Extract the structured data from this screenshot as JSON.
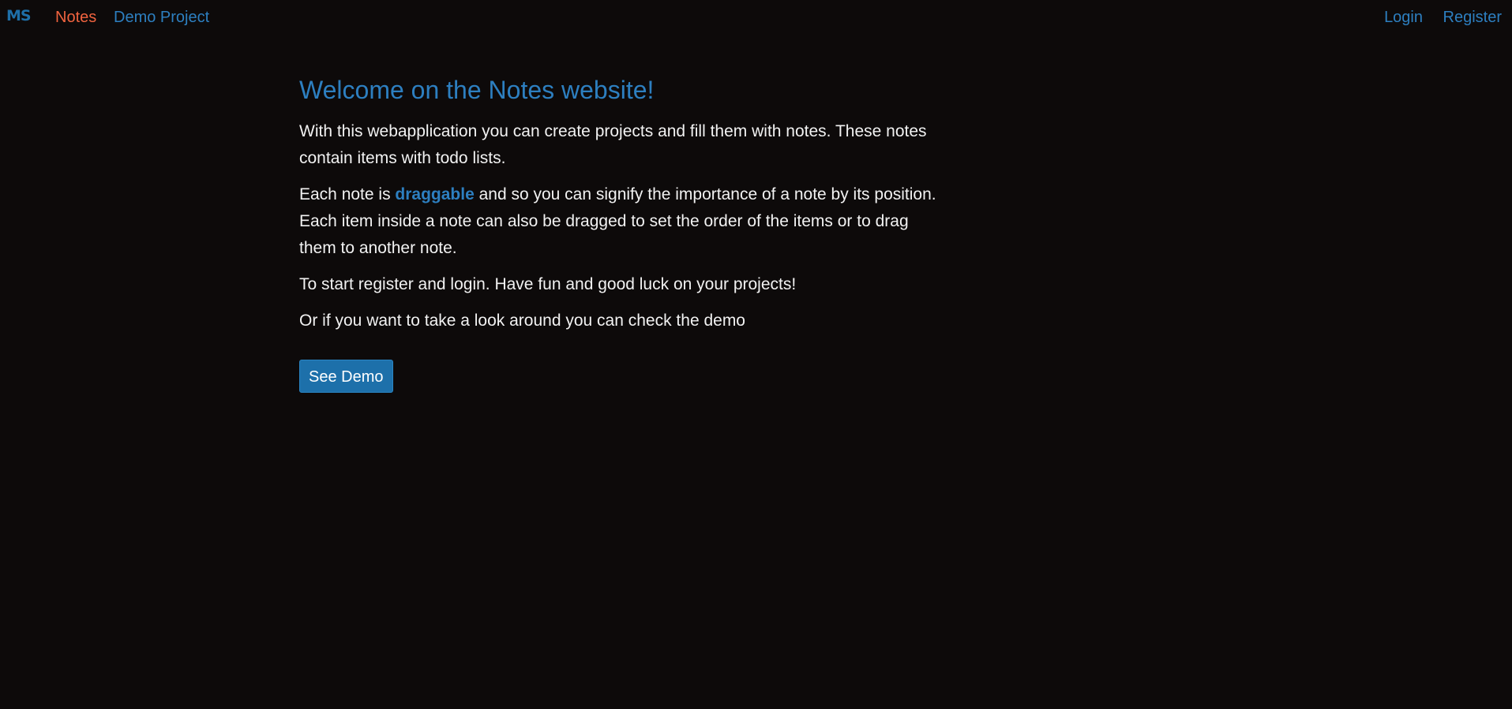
{
  "navbar": {
    "logo": "MS",
    "links": [
      {
        "label": "Notes",
        "active": true
      },
      {
        "label": "Demo Project",
        "active": false
      }
    ],
    "right_links": [
      {
        "label": "Login"
      },
      {
        "label": "Register"
      }
    ]
  },
  "content": {
    "title": "Welcome on the Notes website!",
    "intro": "With this webapplication you can create projects and fill them with notes. These notes contain items with todo lists.",
    "drag_prefix": "Each note is ",
    "drag_highlight": "draggable",
    "drag_suffix": " and so you can signify the importance of a note by its position. Each item inside a note can also be dragged to set the order of the items or to drag them to another note.",
    "start": "To start register and login. Have fun and good luck on your projects!",
    "demo_hint": "Or if you want to take a look around you can check the demo",
    "demo_button": "See Demo"
  },
  "colors": {
    "background": "#0d0a0a",
    "accent": "#2d7fc0",
    "active_link": "#f0633f",
    "button": "#1d70aa",
    "text": "#f2f2f2"
  }
}
